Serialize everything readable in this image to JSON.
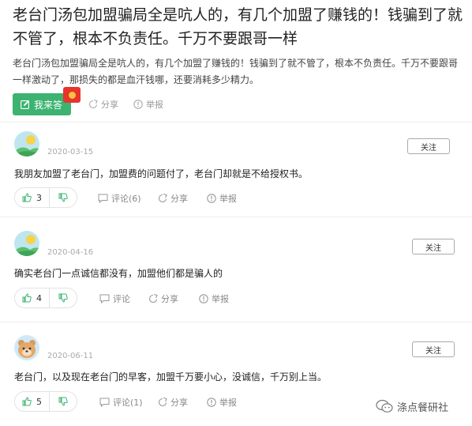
{
  "question": {
    "title": "老台门汤包加盟骗局全是吭人的，有几个加盟了赚钱的！钱骗到了就不管了，根本不负责任。千万不要跟哥一样",
    "description": "老台门汤包加盟骗局全是吭人的，有几个加盟了赚钱的！钱骗到了就不管了，根本不负责任。千万不要跟哥一样激动了，那损失的都是血汗钱哪，还要消耗多少精力。",
    "answer_label": "我来答",
    "share_label": "分享",
    "report_label": "举报"
  },
  "answers": [
    {
      "date": "2020-03-15",
      "follow_label": "关注",
      "text": "我朋友加盟了老台门，加盟费的问题付了，老台门却就是不给授权书。",
      "upvotes": "3",
      "comment_label": "评论(6)",
      "share_label": "分享",
      "report_label": "举报"
    },
    {
      "date": "2020-04-16",
      "follow_label": "关注",
      "text": "确实老台门一点诚信都没有，加盟他们都是骗人的",
      "upvotes": "4",
      "comment_label": "评论",
      "share_label": "分享",
      "report_label": "举报"
    },
    {
      "date": "2020-06-11",
      "follow_label": "关注",
      "text": "老台门，以及现在老台门的早客，加盟千万要小心，没诚信，千万别上当。",
      "upvotes": "5",
      "comment_label": "评论(1)",
      "share_label": "分享",
      "report_label": "举报"
    }
  ],
  "watermark": {
    "text": "涤点餐研社",
    "icon": "wechat-official-account-icon"
  },
  "colors": {
    "accent": "#3cb371",
    "redpack": "#e8342c"
  }
}
